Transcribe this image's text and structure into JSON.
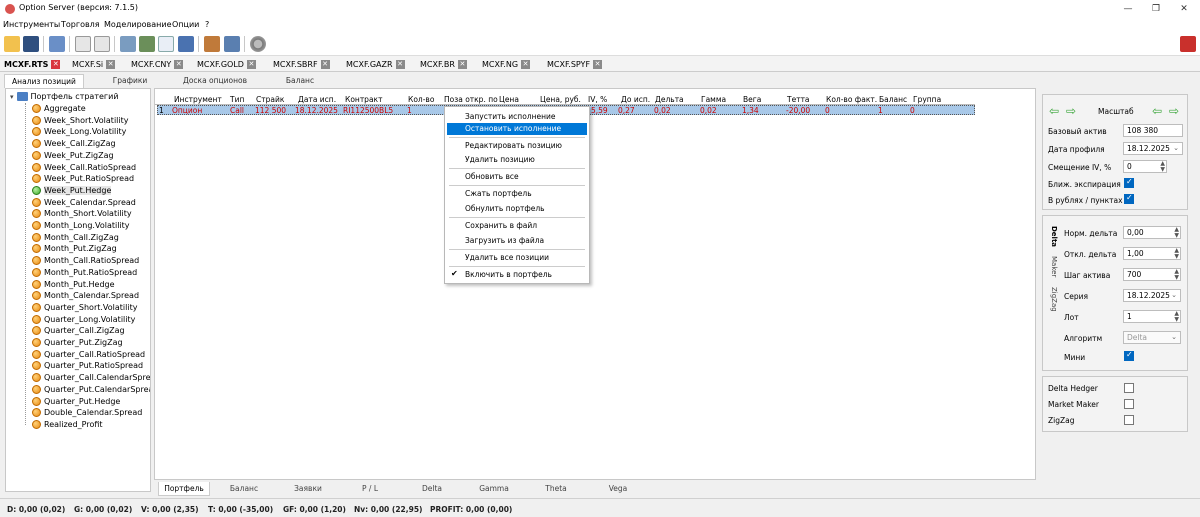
{
  "window": {
    "title": "Option Server (версия: 7.1.5)",
    "minimize": "—",
    "restore": "❐",
    "close": "✕"
  },
  "menu": [
    "Инструменты",
    "Торговля",
    "Моделирование",
    "Опции",
    "?"
  ],
  "instrument_tabs": [
    {
      "label": "MCXF.RTS",
      "active": true
    },
    {
      "label": "MCXF.Si"
    },
    {
      "label": "MCXF.CNY"
    },
    {
      "label": "MCXF.GOLD"
    },
    {
      "label": "MCXF.SBRF"
    },
    {
      "label": "MCXF.GAZR"
    },
    {
      "label": "MCXF.BR"
    },
    {
      "label": "MCXF.NG"
    },
    {
      "label": "MCXF.SPYF"
    }
  ],
  "main_tabs": [
    "Анализ позиций",
    "Графики",
    "Доска опционов",
    "Баланс"
  ],
  "tree": {
    "root": "Портфель стратегий",
    "items": [
      "Aggregate",
      "Week_Short.Volatility",
      "Week_Long.Volatility",
      "Week_Call.ZigZag",
      "Week_Put.ZigZag",
      "Week_Call.RatioSpread",
      "Week_Put.RatioSpread",
      "Week_Put.Hedge",
      "Week_Calendar.Spread",
      "Month_Short.Volatility",
      "Month_Long.Volatility",
      "Month_Call.ZigZag",
      "Month_Put.ZigZag",
      "Month_Call.RatioSpread",
      "Month_Put.RatioSpread",
      "Month_Put.Hedge",
      "Month_Calendar.Spread",
      "Quarter_Short.Volatility",
      "Quarter_Long.Volatility",
      "Quarter_Call.ZigZag",
      "Quarter_Put.ZigZag",
      "Quarter_Call.RatioSpread",
      "Quarter_Put.RatioSpread",
      "Quarter_Call.CalendarSpread",
      "Quarter_Put.CalendarSpread",
      "Quarter_Put.Hedge",
      "Double_Calendar.Spread",
      "Realized_Profit"
    ],
    "selected_index": 7
  },
  "grid": {
    "columns": [
      "Инструмент",
      "Тип",
      "Страйк",
      "Дата исп.",
      "Контракт",
      "Кол-во",
      "Поза откр. по",
      "Цена",
      "Цена, руб.",
      "IV, %",
      "До исп.",
      "Дельта",
      "Гамма",
      "Вега",
      "Тетта",
      "Кол-во факт.",
      "Баланс",
      "Группа"
    ],
    "row": {
      "num": "1",
      "instrument": "Опцион",
      "type": "Call",
      "strike": "112 500",
      "exp_date": "18.12.2025",
      "contract": "RI112500BL5",
      "qty": "1",
      "iv": "5,59",
      "to_exp": "0,27",
      "delta": "0,02",
      "gamma": "0,02",
      "vega": "1,34",
      "theta": "-20,00",
      "qty_fact": "0",
      "balance": "1",
      "group": "0"
    }
  },
  "context_menu": {
    "items": [
      {
        "label": "Запустить исполнение"
      },
      {
        "label": "Остановить исполнение",
        "highlighted": true
      },
      {
        "label": "Редактировать позицию"
      },
      {
        "label": "Удалить позицию"
      },
      {
        "label": "Обновить все"
      },
      {
        "label": "Сжать портфель"
      },
      {
        "label": "Обнулить портфель"
      },
      {
        "label": "Сохранить в файл"
      },
      {
        "label": "Загрузить из файла"
      },
      {
        "label": "Удалить все позиции"
      },
      {
        "label": "Включить в портфель",
        "checked": true
      }
    ],
    "check_glyph": "✔"
  },
  "bottom_tabs": [
    "Портфель",
    "Баланс",
    "Заявки",
    "P / L",
    "Delta",
    "Gamma",
    "Theta",
    "Vega"
  ],
  "status": [
    "D: 0,00  (0,02)",
    "G: 0,00  (0,02)",
    "V: 0,00  (2,35)",
    "T: 0,00  (-35,00)",
    "GF: 0,00  (1,20)",
    "Nv: 0,00  (22,95)",
    "PROFIT: 0,00  (0,00)"
  ],
  "scale_panel": {
    "title": "Масштаб",
    "base_asset_label": "Базовый актив",
    "base_asset_value": "108 380",
    "profile_date_label": "Дата профиля",
    "profile_date_value": "18.12.2025",
    "iv_shift_label": "Смещение IV, %",
    "iv_shift_value": "0",
    "near_exp_label": "Ближ. экспирация",
    "near_exp_checked": true,
    "rub_points_label": "В рублях / пунктах",
    "rub_points_checked": true
  },
  "hedge_panel": {
    "vtabs": [
      "Delta",
      "Maker",
      "ZigZag"
    ],
    "norm_delta_label": "Норм. дельта",
    "norm_delta_value": "0,00",
    "dev_delta_label": "Откл. дельта",
    "dev_delta_value": "1,00",
    "step_label": "Шаг актива",
    "step_value": "700",
    "series_label": "Серия",
    "series_value": "18.12.2025",
    "lot_label": "Лот",
    "lot_value": "1",
    "algo_label": "Алгоритм",
    "algo_value": "Delta",
    "mini_label": "Мини",
    "mini_checked": true
  },
  "strategy_panel": {
    "delta_hedger_label": "Delta Hedger",
    "delta_hedger_checked": false,
    "market_maker_label": "Market Maker",
    "market_maker_checked": false,
    "zigzag_label": "ZigZag",
    "zigzag_checked": false
  },
  "colors": {
    "accent": "#0078d7",
    "grid_text": "#cc0000",
    "row_highlight": "#a8c8e8",
    "close_x": "#d9363e"
  }
}
